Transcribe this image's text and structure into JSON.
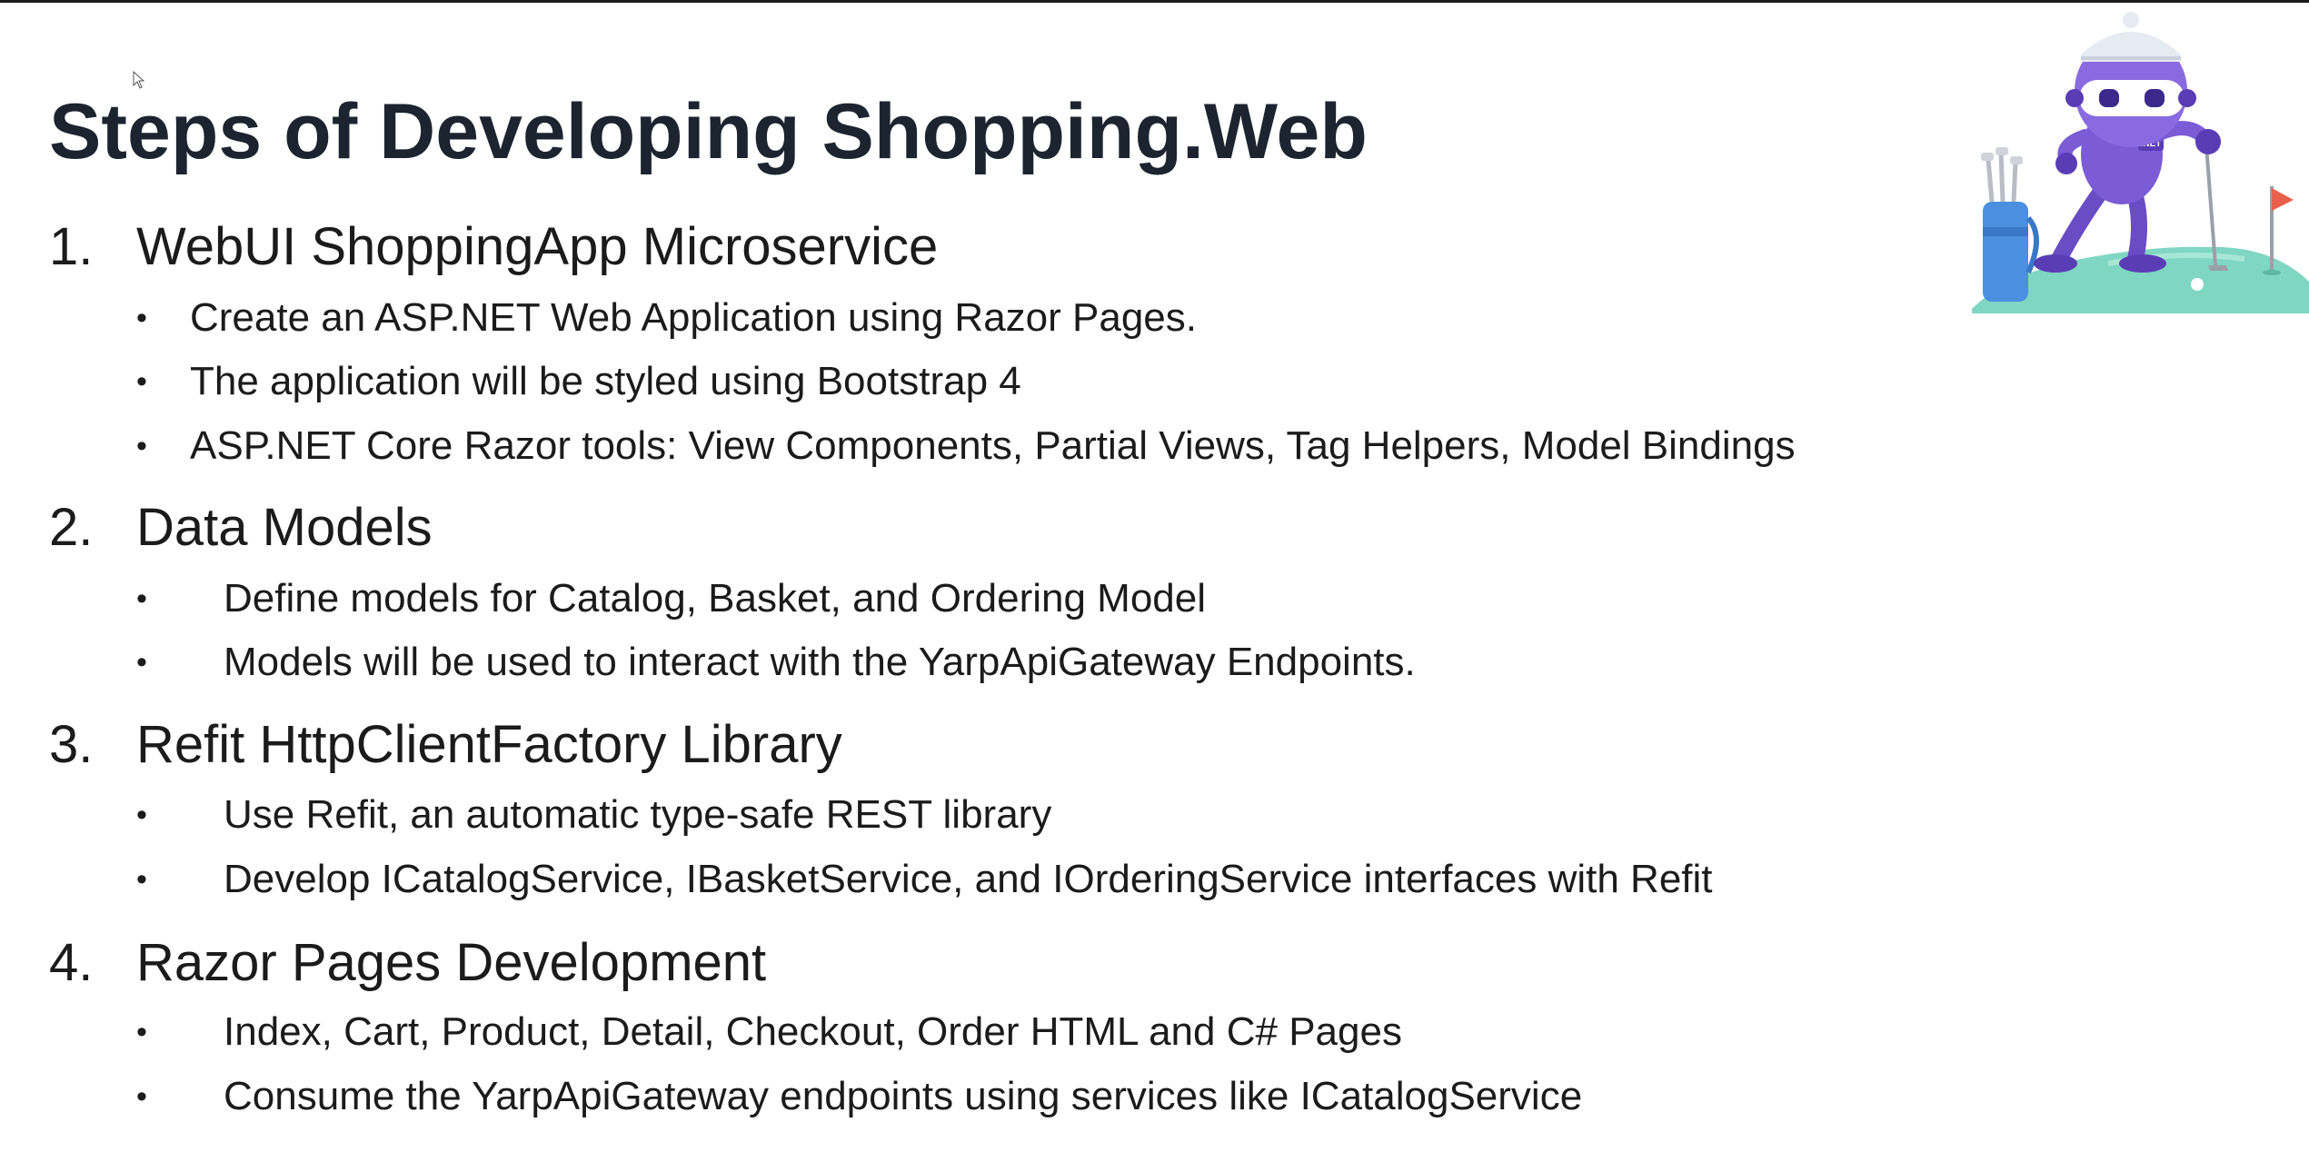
{
  "slide": {
    "title": "Steps of Developing Shopping.Web",
    "steps": [
      {
        "number": "1.",
        "heading": "WebUI ShoppingApp Microservice",
        "bullets": [
          "Create an ASP.NET Web Application using Razor Pages.",
          "The application will be styled using Bootstrap 4",
          "ASP.NET Core Razor tools: View Components, Partial Views, Tag Helpers, Model Bindings"
        ]
      },
      {
        "number": "2.",
        "heading": "Data Models",
        "bullets": [
          "Define models for Catalog, Basket, and Ordering Model",
          "Models will be used to interact with the YarpApiGateway Endpoints."
        ]
      },
      {
        "number": "3.",
        "heading": "Refit HttpClientFactory Library",
        "bullets": [
          "Use Refit, an automatic type-safe REST library",
          "Develop ICatalogService, IBasketService, and IOrderingService interfaces with Refit"
        ]
      },
      {
        "number": "4.",
        "heading": "Razor Pages Development",
        "bullets": [
          "Index, Cart, Product, Detail, Checkout, Order HTML and C# Pages",
          "Consume the YarpApiGateway endpoints using services like ICatalogService"
        ]
      }
    ],
    "bullet_glyph": "•",
    "mascot": {
      "icon": "dotnet-bot-golf-icon",
      "badge_text": ".NET"
    }
  },
  "colors": {
    "title": "#1c2430",
    "text": "#1b1b1b",
    "mascot_purple": "#7b5bd6",
    "grass": "#7fd6c2",
    "flag": "#e8604c",
    "bag": "#4b8fe0"
  }
}
